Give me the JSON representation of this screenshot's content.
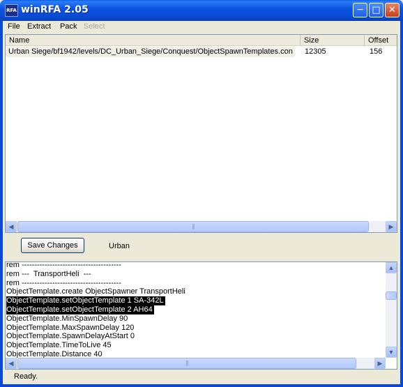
{
  "window": {
    "title": "winRFA 2.05",
    "icon_label": "RFA",
    "minimize_icon": "minimize-icon",
    "maximize_icon": "maximize-icon",
    "close_icon": "close-icon"
  },
  "menu": {
    "items": [
      "File",
      "Extract",
      "Pack",
      "Select"
    ],
    "disabled": [
      "Select"
    ]
  },
  "file_list": {
    "columns": [
      "Name",
      "Size",
      "Offset"
    ],
    "rows": [
      {
        "name": "Urban Siege/bf1942/levels/DC_Urban_Siege/Conquest/ObjectSpawnTemplates.con",
        "size": "12305",
        "offset": "156"
      }
    ]
  },
  "middle": {
    "save_button": "Save Changes",
    "label": "Urban"
  },
  "editor": {
    "lines": [
      "rem ---------------------------------------",
      "rem ---  TransportHeli  ---",
      "rem ---------------------------------------",
      "ObjectTemplate.create ObjectSpawner TransportHeli",
      "ObjectTemplate.setObjectTemplate 1 SA-342L",
      "ObjectTemplate.setObjectTemplate 2 AH64",
      "ObjectTemplate.MinSpawnDelay 90",
      "ObjectTemplate.MaxSpawnDelay 120",
      "ObjectTemplate.SpawnDelayAtStart 0",
      "ObjectTemplate.TimeToLive 45",
      "ObjectTemplate.Distance 40"
    ],
    "selected_lines": [
      4,
      5
    ]
  },
  "status": {
    "text": "Ready."
  },
  "colors": {
    "titlebar": "#0a55e3",
    "selection": "#000000",
    "close_button": "#c3401f"
  }
}
